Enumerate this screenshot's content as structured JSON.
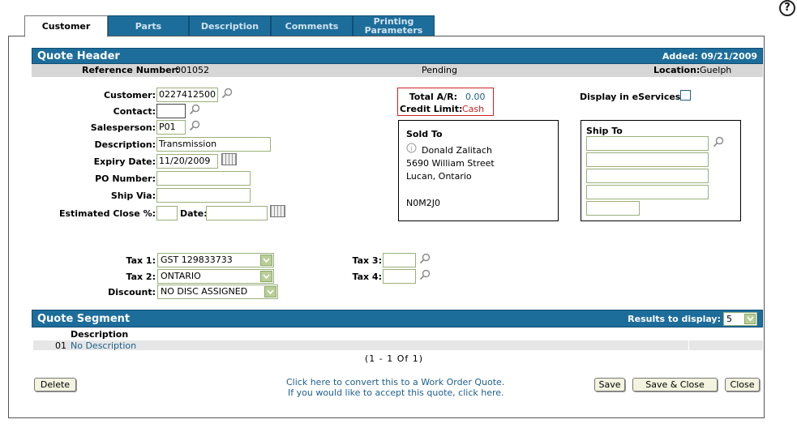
{
  "help": {
    "label": "?"
  },
  "tabs": [
    {
      "label": "Customer"
    },
    {
      "label": "Parts"
    },
    {
      "label": "Description"
    },
    {
      "label": "Comments"
    },
    {
      "label": "Printing Parameters"
    }
  ],
  "quote_header": {
    "title": "Quote Header",
    "added": "Added: 09/21/2009",
    "reference_label": "Reference Number:",
    "reference_value": "001052",
    "status": "Pending",
    "location_label": "Location:",
    "location_value": "Guelph"
  },
  "form": {
    "customer_label": "Customer:",
    "customer_value": "0227412500",
    "contact_label": "Contact:",
    "contact_value": "",
    "salesperson_label": "Salesperson:",
    "salesperson_value": "P01",
    "description_label": "Description:",
    "description_value": "Transmission",
    "expiry_label": "Expiry Date:",
    "expiry_value": "11/20/2009",
    "po_label": "PO Number:",
    "po_value": "",
    "shipvia_label": "Ship Via:",
    "shipvia_value": "",
    "estclose_label": "Estimated Close %:",
    "estclose_value": "",
    "date_label": "Date:",
    "date_value": ""
  },
  "ar": {
    "total_label": "Total A/R:",
    "total_value": "0.00",
    "credit_label": "Credit Limit:",
    "credit_value": "Cash"
  },
  "eservices": {
    "label": "Display in eServices:"
  },
  "sold_to": {
    "title": "Sold To",
    "name": "Donald Zalitach",
    "street": "5690 William Street",
    "city": "Lucan, Ontario",
    "postal": "N0M2J0"
  },
  "ship_to": {
    "title": "Ship To"
  },
  "tax": {
    "tax1_label": "Tax 1:",
    "tax1_value": "GST 129833733",
    "tax2_label": "Tax 2:",
    "tax2_value": "ONTARIO",
    "discount_label": "Discount:",
    "discount_value": "NO DISC ASSIGNED",
    "tax3_label": "Tax 3:",
    "tax4_label": "Tax 4:"
  },
  "segment": {
    "title": "Quote Segment",
    "results_label": "Results to display:",
    "results_value": "5",
    "col_description": "Description",
    "rows": [
      {
        "num": "01",
        "desc": "No Description"
      }
    ],
    "pager": "(1 - 1 Of 1)"
  },
  "footer": {
    "delete": "Delete",
    "convert_link": "Click here to convert this to a Work Order Quote.",
    "accept_link": "If you would like to accept this quote, click here.",
    "save": "Save",
    "save_close": "Save & Close",
    "close": "Close"
  },
  "colors": {
    "accent": "#1d6d9b",
    "error_red": "#cc2222"
  }
}
